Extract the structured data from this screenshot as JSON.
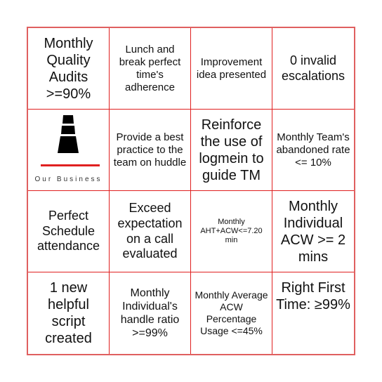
{
  "card": {
    "border_color": "#e02020",
    "cells": [
      {
        "text": "Monthly Quality Audits >=90%",
        "size": "xl"
      },
      {
        "text": "Lunch and break perfect time's adherence",
        "size": "s"
      },
      {
        "text": "Improvement idea presented",
        "size": "s"
      },
      {
        "text": "0 invalid escalations",
        "size": "l"
      },
      {
        "type": "logo",
        "logo_text": "Our Business",
        "logo_icon": "cone-icon"
      },
      {
        "text": "Provide a best practice to the team on huddle",
        "size": "s"
      },
      {
        "text": "Reinforce the use of logmein to guide TM",
        "size": "xl"
      },
      {
        "text": "Monthly Team's abandoned rate <= 10%",
        "size": "s"
      },
      {
        "text": "Perfect Schedule attendance",
        "size": "l"
      },
      {
        "text": "Exceed expectation on a call evaluated",
        "size": "l"
      },
      {
        "text": "Monthly AHT+ACW<=7.20 min",
        "size": "xs"
      },
      {
        "text": "Monthly Individual ACW >= 2 mins",
        "size": "xl"
      },
      {
        "text": "1 new helpful script created",
        "size": "xl"
      },
      {
        "text": "Monthly Individual's handle ratio >=99%",
        "size": "m"
      },
      {
        "text": "Monthly Average ACW Percentage Usage <=45%",
        "size": "s"
      },
      {
        "text": "Right First Time: ≥99%",
        "size": "xl"
      }
    ]
  }
}
